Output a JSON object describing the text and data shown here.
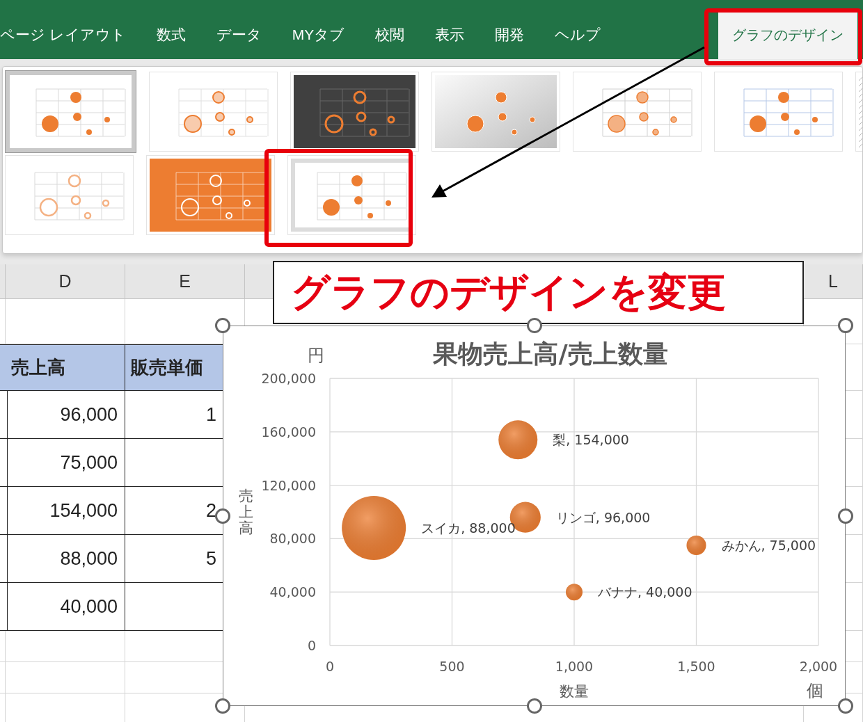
{
  "ribbon": {
    "tabs": [
      {
        "label": "ページ レイアウト",
        "selected": false
      },
      {
        "label": "数式",
        "selected": false
      },
      {
        "label": "データ",
        "selected": false
      },
      {
        "label": "MYタブ",
        "selected": false
      },
      {
        "label": "校閲",
        "selected": false
      },
      {
        "label": "表示",
        "selected": false
      },
      {
        "label": "開発",
        "selected": false
      },
      {
        "label": "ヘルプ",
        "selected": false
      },
      {
        "label": "グラフのデザイン",
        "selected": true
      }
    ]
  },
  "style_gallery": {
    "rows": [
      [
        {
          "kind": "framed",
          "selected": true
        },
        {
          "kind": "outline",
          "selected": false
        },
        {
          "kind": "dark",
          "selected": false
        },
        {
          "kind": "gradient",
          "selected": false
        },
        {
          "kind": "pale",
          "selected": false
        },
        {
          "kind": "blue",
          "selected": false
        },
        {
          "kind": "hatched",
          "selected": false
        }
      ],
      [
        {
          "kind": "ring",
          "selected": false
        },
        {
          "kind": "orange",
          "selected": false
        },
        {
          "kind": "shaded",
          "selected": false
        }
      ]
    ]
  },
  "callout": {
    "text": "グラフのデザインを変更"
  },
  "sheet": {
    "column_headers": [
      "D",
      "E",
      "L"
    ],
    "table": {
      "header": [
        "売上高",
        "販売単価"
      ],
      "rows": [
        {
          "sales": "96,000",
          "unit_price": "1"
        },
        {
          "sales": "75,000"
        },
        {
          "sales": "154,000",
          "unit_price": "2"
        },
        {
          "sales": "88,000",
          "unit_price": "5"
        },
        {
          "sales": "40,000"
        }
      ]
    }
  },
  "chart": {
    "y_unit": "円",
    "x_unit": "個",
    "chart_data": {
      "type": "scatter",
      "title": "果物売上高/売上数量",
      "xlabel": "数量",
      "ylabel": "売上高",
      "x": [
        770,
        180,
        800,
        1500,
        1000
      ],
      "grid": true,
      "series": [
        {
          "color": "#ed7d31",
          "values": [
            154000,
            88000,
            96000,
            75000,
            40000
          ],
          "sizes": [
            0.37,
            1,
            0.23,
            0.093,
            0.068
          ]
        }
      ],
      "xlim": [
        0,
        2000
      ],
      "ylim": [
        0,
        200000
      ],
      "xticks": [
        {
          "value": 0,
          "label": "0"
        },
        {
          "value": 500,
          "label": "500"
        },
        {
          "value": 1000,
          "label": "1,000"
        },
        {
          "value": 1500,
          "label": "1,500"
        },
        {
          "value": 2000,
          "label": "2,000"
        }
      ],
      "yticks": [
        {
          "value": 0,
          "label": "0"
        },
        {
          "value": 40000,
          "label": "40,000"
        },
        {
          "value": 80000,
          "label": "80,000"
        },
        {
          "value": 120000,
          "label": "120,000"
        },
        {
          "value": 160000,
          "label": "160,000"
        },
        {
          "value": 200000,
          "label": "200,000"
        }
      ],
      "value_labels": [
        "梨, 154,000",
        "スイカ, 88,000",
        "リンゴ, 96,000",
        "みかん, 75,000",
        "バナナ, 40,000"
      ]
    }
  }
}
